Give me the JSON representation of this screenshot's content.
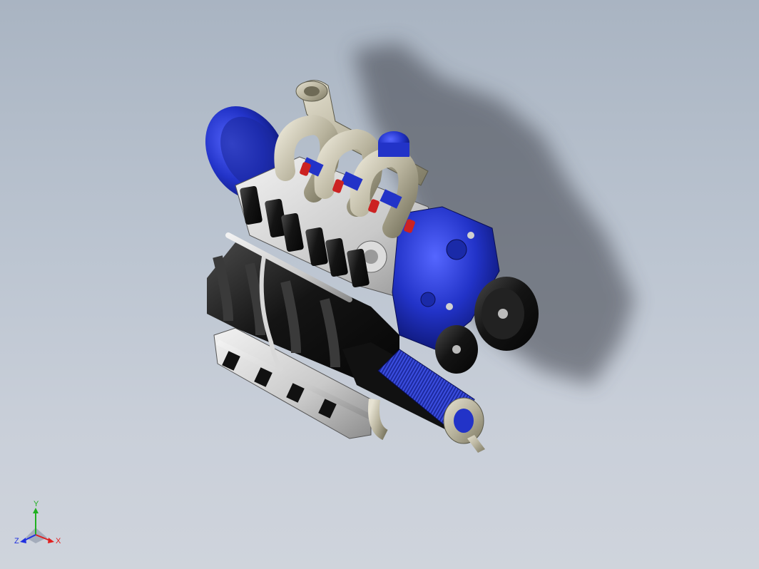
{
  "viewport": {
    "background_top": "#a9b4c2",
    "background_bottom": "#cfd4dc"
  },
  "model": {
    "description_icon": "v8-engine-assembly",
    "colors": {
      "blue_parts": "#2233c8",
      "black_parts": "#141414",
      "silver_parts": "#c9c9c9",
      "manifold_tan": "#b8b39d",
      "plug_red": "#cc2222",
      "shadow": "#3c4048"
    }
  },
  "triad": {
    "x_label": "X",
    "y_label": "Y",
    "z_label": "Z",
    "x_color": "#e02020",
    "y_color": "#20b020",
    "z_color": "#2030e0"
  }
}
